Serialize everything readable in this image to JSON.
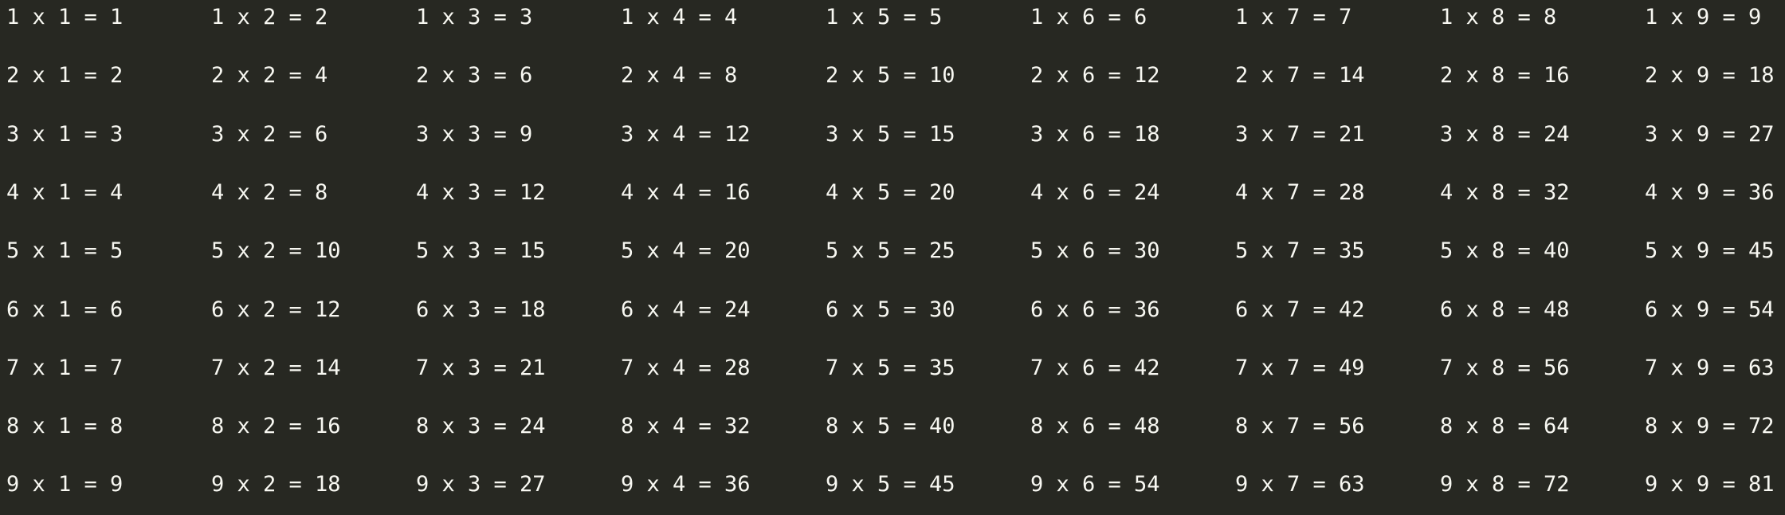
{
  "theme": {
    "background": "#272822",
    "text": "#f8f8f2"
  },
  "multiplication_table": {
    "rows": [
      [
        "1 x 1 = 1",
        "1 x 2 = 2",
        "1 x 3 = 3",
        "1 x 4 = 4",
        "1 x 5 = 5",
        "1 x 6 = 6",
        "1 x 7 = 7",
        "1 x 8 = 8",
        "1 x 9 = 9"
      ],
      [
        "2 x 1 = 2",
        "2 x 2 = 4",
        "2 x 3 = 6",
        "2 x 4 = 8",
        "2 x 5 = 10",
        "2 x 6 = 12",
        "2 x 7 = 14",
        "2 x 8 = 16",
        "2 x 9 = 18"
      ],
      [
        "3 x 1 = 3",
        "3 x 2 = 6",
        "3 x 3 = 9",
        "3 x 4 = 12",
        "3 x 5 = 15",
        "3 x 6 = 18",
        "3 x 7 = 21",
        "3 x 8 = 24",
        "3 x 9 = 27"
      ],
      [
        "4 x 1 = 4",
        "4 x 2 = 8",
        "4 x 3 = 12",
        "4 x 4 = 16",
        "4 x 5 = 20",
        "4 x 6 = 24",
        "4 x 7 = 28",
        "4 x 8 = 32",
        "4 x 9 = 36"
      ],
      [
        "5 x 1 = 5",
        "5 x 2 = 10",
        "5 x 3 = 15",
        "5 x 4 = 20",
        "5 x 5 = 25",
        "5 x 6 = 30",
        "5 x 7 = 35",
        "5 x 8 = 40",
        "5 x 9 = 45"
      ],
      [
        "6 x 1 = 6",
        "6 x 2 = 12",
        "6 x 3 = 18",
        "6 x 4 = 24",
        "6 x 5 = 30",
        "6 x 6 = 36",
        "6 x 7 = 42",
        "6 x 8 = 48",
        "6 x 9 = 54"
      ],
      [
        "7 x 1 = 7",
        "7 x 2 = 14",
        "7 x 3 = 21",
        "7 x 4 = 28",
        "7 x 5 = 35",
        "7 x 6 = 42",
        "7 x 7 = 49",
        "7 x 8 = 56",
        "7 x 9 = 63"
      ],
      [
        "8 x 1 = 8",
        "8 x 2 = 16",
        "8 x 3 = 24",
        "8 x 4 = 32",
        "8 x 5 = 40",
        "8 x 6 = 48",
        "8 x 7 = 56",
        "8 x 8 = 64",
        "8 x 9 = 72"
      ],
      [
        "9 x 1 = 9",
        "9 x 2 = 18",
        "9 x 3 = 27",
        "9 x 4 = 36",
        "9 x 5 = 45",
        "9 x 6 = 54",
        "9 x 7 = 63",
        "9 x 8 = 72",
        "9 x 9 = 81"
      ]
    ]
  }
}
